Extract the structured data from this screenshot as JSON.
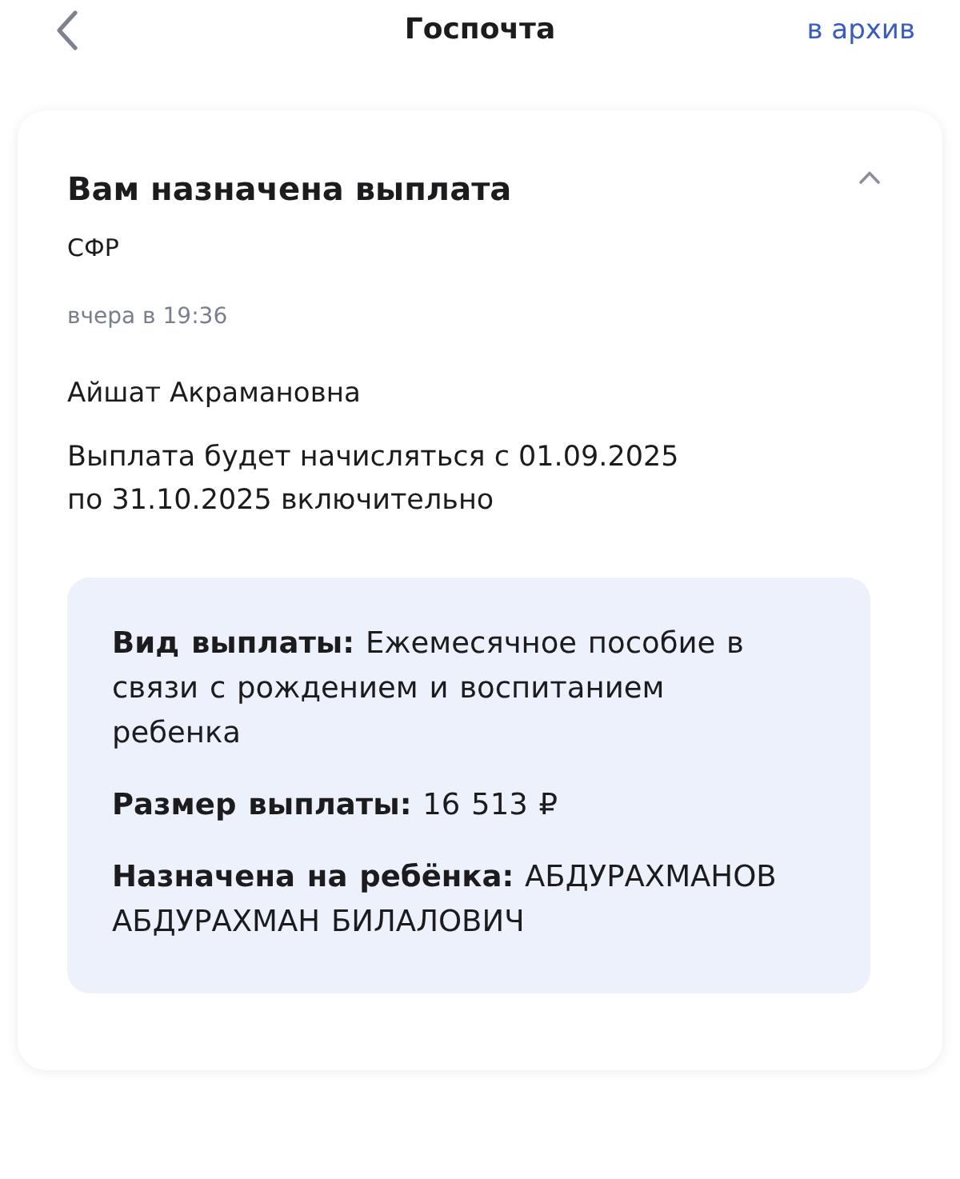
{
  "header": {
    "title": "Госпочта",
    "action": "в архив"
  },
  "message": {
    "title": "Вам назначена выплата",
    "expanded": true,
    "sender": "СФР",
    "time": "вчера в 19:36",
    "recipient": "Айшат Акрамановна",
    "body": "Выплата будет начисляться с 01.09.2025 по 31.10.2025 включительно",
    "details": [
      {
        "label": "Вид выплаты:",
        "value": "Ежемесячное пособие в связи с рождением и воспитанием ребенка"
      },
      {
        "label": "Размер выплаты:",
        "value": "16 513 ₽"
      },
      {
        "label": "Назначена на ребёнка:",
        "value": "АБДУРАХМАНОВ АБДУРАХМАН БИЛАЛОВИЧ"
      }
    ]
  }
}
